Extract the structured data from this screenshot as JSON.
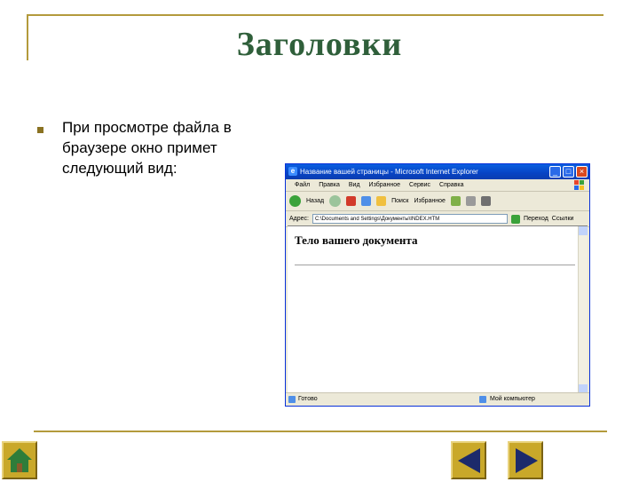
{
  "slide": {
    "title": "Заголовки",
    "bullet_text": "При просмотре файла в браузере окно примет следующий вид:"
  },
  "browser": {
    "window_title": "Название вашей страницы - Microsoft Internet Explorer",
    "menu_items": [
      "Файл",
      "Правка",
      "Вид",
      "Избранное",
      "Сервис",
      "Справка"
    ],
    "toolbar": {
      "back_label": "Назад",
      "search_label": "Поиск",
      "favorites_label": "Избранное"
    },
    "address": {
      "label": "Адрес:",
      "value": "C:\\Documents and Settings\\Документы\\INDEX.HTM",
      "go_label": "Переход",
      "links_label": "Ссылки"
    },
    "document_heading": "Тело вашего документа",
    "status": {
      "left": "Готово",
      "right": "Мой компьютер"
    }
  },
  "colors": {
    "title": "#2f5f3a",
    "frame": "#b39a3c",
    "nav_button": "#c9a82a",
    "arrow": "#1c2a6b"
  },
  "icons": [
    "home-icon",
    "previous-arrow-icon",
    "next-arrow-icon"
  ]
}
